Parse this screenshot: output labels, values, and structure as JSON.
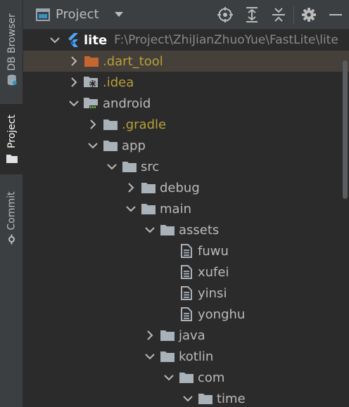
{
  "stripe": {
    "tabs": [
      {
        "label": "DB Browser",
        "icon": "database-icon"
      },
      {
        "label": "Project",
        "icon": "folder-icon"
      },
      {
        "label": "Commit",
        "icon": "commit-icon"
      }
    ]
  },
  "header": {
    "view_label": "Project",
    "icons": [
      "locate-target-icon",
      "expand-all-icon",
      "collapse-all-icon",
      "settings-gear-icon",
      "hide-minimize-icon"
    ]
  },
  "colors": {
    "background": "#2b2b2b",
    "selected_row": "#45403a",
    "ignored_text": "#b8a038",
    "folder_icon": "#a9b1b9",
    "excluded_folder": "#c5652f",
    "flutter_blue": "#4fa5f5"
  },
  "tree": [
    {
      "name": "lite",
      "path": "F:\\Project\\ZhiJianZhuoYue\\FastLite\\lite",
      "depth": 0,
      "expanded": true,
      "type": "module-root",
      "icon": "flutter-icon"
    },
    {
      "name": ".dart_tool",
      "depth": 1,
      "expanded": false,
      "type": "excluded",
      "icon": "excluded-folder-icon",
      "selected": true
    },
    {
      "name": ".idea",
      "depth": 1,
      "expanded": false,
      "type": "ignored",
      "icon": "settings-folder-icon"
    },
    {
      "name": "android",
      "depth": 1,
      "expanded": true,
      "type": "folder",
      "icon": "android-module-icon"
    },
    {
      "name": ".gradle",
      "depth": 2,
      "expanded": false,
      "type": "ignored",
      "icon": "folder-icon"
    },
    {
      "name": "app",
      "depth": 2,
      "expanded": true,
      "type": "folder",
      "icon": "folder-icon"
    },
    {
      "name": "src",
      "depth": 3,
      "expanded": true,
      "type": "folder",
      "icon": "folder-icon"
    },
    {
      "name": "debug",
      "depth": 4,
      "expanded": false,
      "type": "folder",
      "icon": "folder-icon"
    },
    {
      "name": "main",
      "depth": 4,
      "expanded": true,
      "type": "folder",
      "icon": "folder-icon"
    },
    {
      "name": "assets",
      "depth": 5,
      "expanded": true,
      "type": "folder",
      "icon": "folder-icon"
    },
    {
      "name": "fuwu",
      "depth": 6,
      "type": "file",
      "icon": "text-file-icon"
    },
    {
      "name": "xufei",
      "depth": 6,
      "type": "file",
      "icon": "text-file-icon"
    },
    {
      "name": "yinsi",
      "depth": 6,
      "type": "file",
      "icon": "text-file-icon"
    },
    {
      "name": "yonghu",
      "depth": 6,
      "type": "file",
      "icon": "text-file-icon"
    },
    {
      "name": "java",
      "depth": 5,
      "expanded": false,
      "type": "folder",
      "icon": "folder-icon"
    },
    {
      "name": "kotlin",
      "depth": 5,
      "expanded": true,
      "type": "folder",
      "icon": "folder-icon"
    },
    {
      "name": "com",
      "depth": 6,
      "expanded": true,
      "type": "folder",
      "icon": "folder-icon"
    },
    {
      "name": "time",
      "depth": 7,
      "expanded": true,
      "type": "folder",
      "icon": "folder-icon"
    }
  ]
}
